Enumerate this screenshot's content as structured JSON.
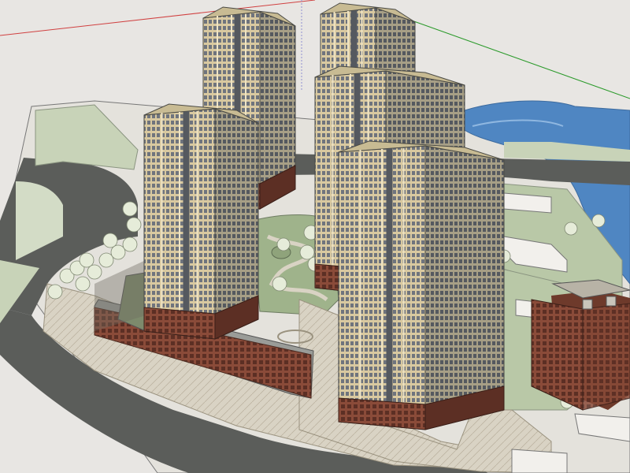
{
  "scene": {
    "description_free": true,
    "colors": {
      "sky": "#e8e6e3",
      "ground_base": "#e4e2dc",
      "road": "#5b5d5a",
      "grass": "#b9c8a7",
      "grass_dark": "#9fb38b",
      "plaza": "#d9d3c4",
      "water": "#4f86c2",
      "tower_face": "#d9c9a0",
      "tower_shadow": "#8f8a7c",
      "tower_dark": "#6e6a60",
      "window_band": "#7b7f87",
      "podium_brick": "#7a3b2c",
      "podium_roof": "#9a9c98",
      "low_building": "#8a4b39",
      "axis_red": "#d04040",
      "axis_green": "#2a9a2a"
    },
    "towers": [
      {
        "id": "tower-back-left"
      },
      {
        "id": "tower-back-right"
      },
      {
        "id": "tower-mid-right"
      },
      {
        "id": "tower-front-left"
      },
      {
        "id": "tower-front-center"
      }
    ]
  }
}
